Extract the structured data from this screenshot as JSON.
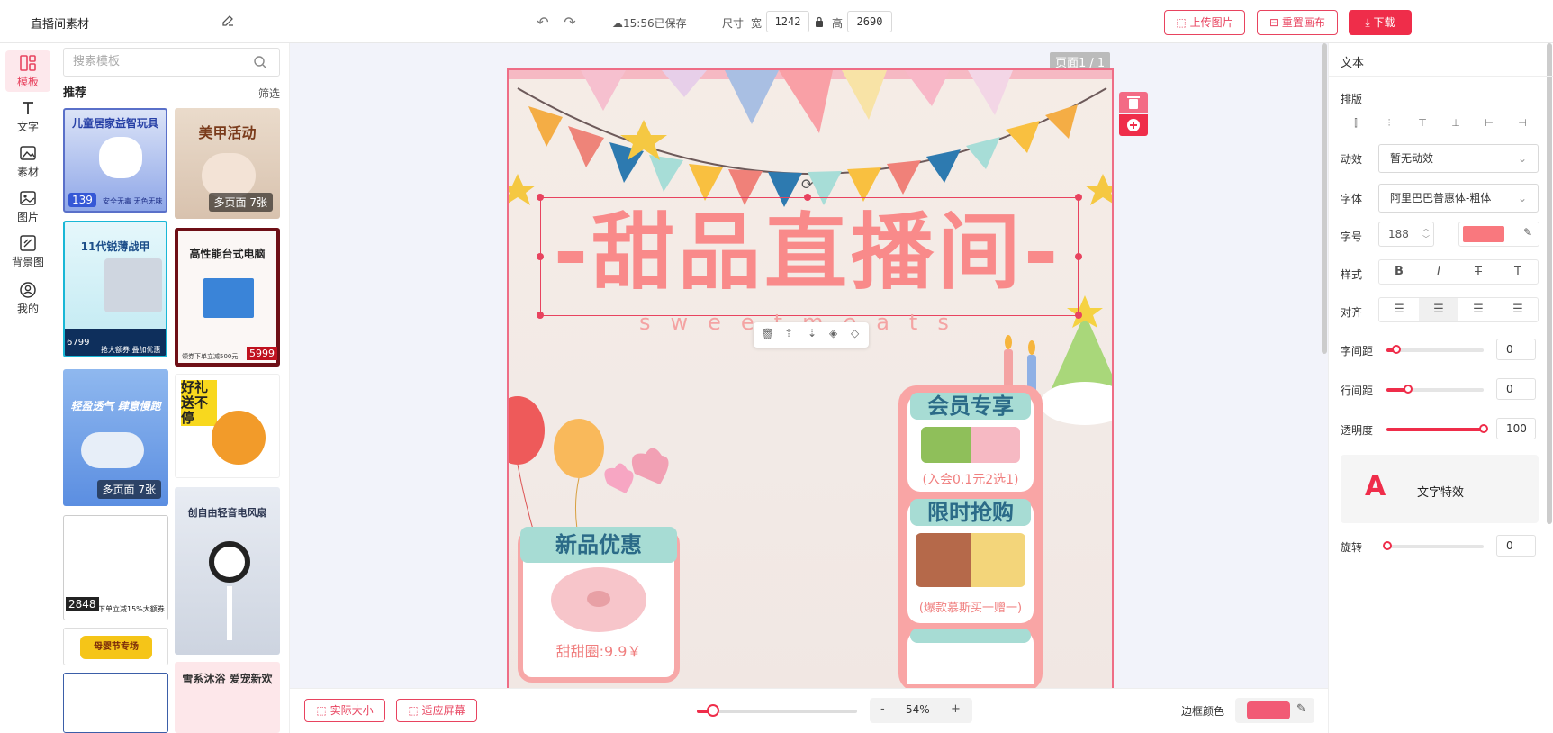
{
  "topbar": {
    "title": "直播间素材",
    "saved": "15:56已保存",
    "size_label": "尺寸",
    "width_label": "宽",
    "width": "1242",
    "height_label": "高",
    "height": "2690",
    "upload": "上传图片",
    "reset": "重置画布",
    "download": "下载"
  },
  "rail": {
    "items": [
      {
        "label": "模板",
        "icon": "template-icon"
      },
      {
        "label": "文字",
        "icon": "text-icon"
      },
      {
        "label": "素材",
        "icon": "material-icon"
      },
      {
        "label": "图片",
        "icon": "image-icon"
      },
      {
        "label": "背景图",
        "icon": "background-icon"
      },
      {
        "label": "我的",
        "icon": "user-icon"
      }
    ]
  },
  "templates": {
    "search_placeholder": "搜索模板",
    "recommend": "推荐",
    "filter": "筛选",
    "items": [
      {
        "title": "儿童居家益智玩具",
        "price": "139",
        "foot": "安全无毒 无色无味"
      },
      {
        "title": "美甲活动",
        "badge": "多页面 7张"
      },
      {
        "title": "11代锐薄战甲",
        "price": "6799",
        "foot": "抢大额券 叠加优惠"
      },
      {
        "title": "高性能台式电脑",
        "price": "5999",
        "foot": "领券下单立减500元"
      },
      {
        "title": "轻盈透气 肆意慢跑",
        "badge": "多页面 7张"
      },
      {
        "title": "好礼 送不停"
      },
      {
        "title": "",
        "price": "2848",
        "foot": "下单立减15%大额券"
      },
      {
        "title": "创自由轻音电风扇"
      },
      {
        "title": "母婴节专场"
      },
      {
        "title": "雪系沐浴 爱宠新欢"
      }
    ]
  },
  "canvas": {
    "page": "页面1 / 1",
    "headline": "-甜品直播间-",
    "subline": "sweetmeats",
    "card_left": {
      "title": "新品优惠",
      "price": "甜甜圈:9.9￥"
    },
    "card_right_1": {
      "title": "会员专享",
      "price": "(入会0.1元2选1)"
    },
    "card_right_2": {
      "title": "限时抢购",
      "price": "(爆款慕斯买一赠一)"
    }
  },
  "bottombar": {
    "actual": "实际大小",
    "fit": "适应屏幕",
    "zoom_minus": "-",
    "zoom": "54%",
    "zoom_plus": "+",
    "zoom_fraction": 0.09,
    "border_color_label": "边框颜色",
    "border_color": "#f25a75"
  },
  "rightpanel": {
    "title": "文本",
    "layout": "排版",
    "anim_label": "动效",
    "anim_value": "暂无动效",
    "font_label": "字体",
    "font_value": "阿里巴巴普惠体-粗体",
    "size_label": "字号",
    "size_value": "188",
    "text_color": "#f9787e",
    "style_label": "样式",
    "style_buttons": [
      "B",
      "I",
      "T",
      "T"
    ],
    "align_label": "对齐",
    "letter_label": "字间距",
    "letter_value": "0",
    "line_label": "行间距",
    "line_value": "0",
    "opacity_label": "透明度",
    "opacity_value": "100",
    "effect_label": "文字特效",
    "effect_glyph": "A",
    "rotate_label": "旋转",
    "rotate_value": "0"
  }
}
